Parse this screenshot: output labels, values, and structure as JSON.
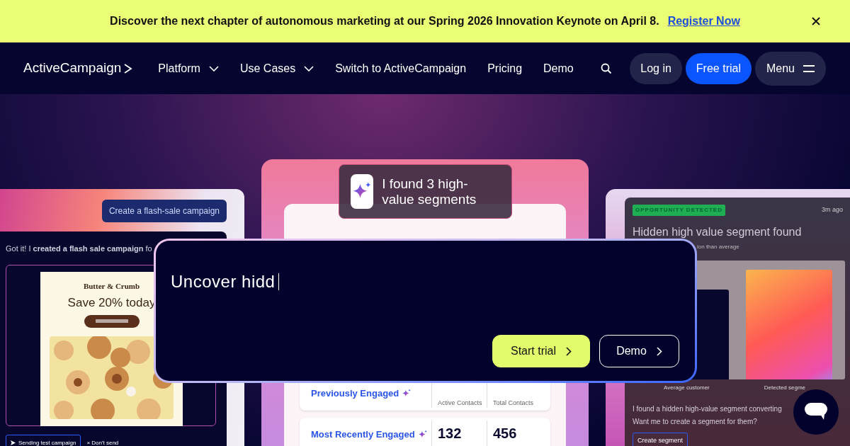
{
  "banner": {
    "text": "Discover the next chapter of autonomous marketing at our Spring 2026 Innovation Keynote on April 8.",
    "link": "Register Now"
  },
  "nav": {
    "logo": "ActiveCampaign",
    "items": [
      {
        "label": "Platform",
        "dropdown": true
      },
      {
        "label": "Use Cases",
        "dropdown": true
      },
      {
        "label": "Switch to ActiveCampaign",
        "dropdown": false
      },
      {
        "label": "Pricing",
        "dropdown": false
      },
      {
        "label": "Demo",
        "dropdown": false
      }
    ],
    "login": "Log in",
    "trial": "Free trial",
    "menu": "Menu"
  },
  "campaign_card": {
    "request": "Create a flash-sale campaign",
    "reply": "Got it! I **created a flash sale campaign** fo",
    "email": {
      "brand": "Butter & Crumb",
      "headline": "Save 20% today"
    },
    "actions": [
      "Sending test campaign",
      "× Don't send"
    ]
  },
  "segments_card": {
    "chip": "I found 3 high-value segments",
    "rows": [
      {
        "name": "Previously Engaged",
        "active_label": "Active Contacts",
        "total_label": "Total Contacts"
      },
      {
        "name": "Most Recently Engaged",
        "active": "132",
        "total": "456"
      }
    ]
  },
  "opportunity_card": {
    "badge": "OPPORTUNITY DETECTED",
    "time": "3m ago",
    "title": "Hidden high value segment found",
    "subtitle": "ion than average",
    "bar_labels": [
      "Average customer",
      "Detected segme"
    ],
    "message": [
      "I found a hidden high-value segment converting",
      "Want me to create a segment for them?"
    ],
    "button": "Create segment"
  },
  "prompt": {
    "typed": "Uncover hidd",
    "buttons": [
      {
        "label": "Start trial",
        "kind": "primary"
      },
      {
        "label": "Demo",
        "kind": "outline"
      }
    ]
  }
}
